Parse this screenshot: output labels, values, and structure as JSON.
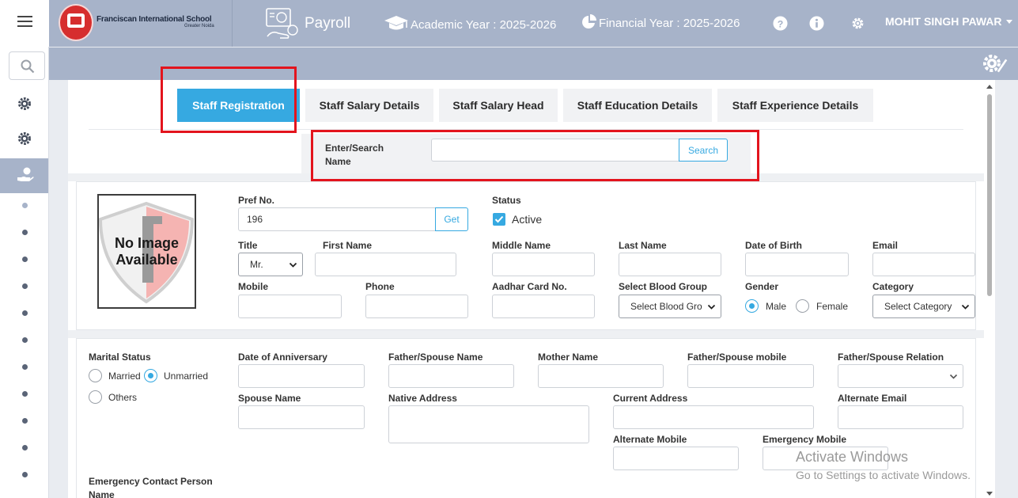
{
  "header": {
    "school_name": "Franciscan International School",
    "school_sub": "Greater Noida",
    "module": "Payroll",
    "academic_year": "Academic Year : 2025-2026",
    "financial_year": "Financial Year : 2025-2026",
    "user": "MOHIT SINGH PAWAR"
  },
  "tabs": [
    {
      "label": "Staff Registration",
      "active": true
    },
    {
      "label": "Staff Salary Details",
      "active": false
    },
    {
      "label": "Staff Salary Head",
      "active": false
    },
    {
      "label": "Staff Education Details",
      "active": false
    },
    {
      "label": "Staff Experience Details",
      "active": false
    }
  ],
  "search": {
    "label": "Enter/Search Name",
    "button": "Search",
    "value": ""
  },
  "photo": {
    "placeholder": "No Image Available"
  },
  "form": {
    "pref_no": {
      "label": "Pref No.",
      "value": "196",
      "button": "Get"
    },
    "status": {
      "label": "Status",
      "option": "Active",
      "checked": true
    },
    "title": {
      "label": "Title",
      "value": "Mr."
    },
    "first_name": {
      "label": "First Name",
      "value": ""
    },
    "middle_name": {
      "label": "Middle Name",
      "value": ""
    },
    "last_name": {
      "label": "Last Name",
      "value": ""
    },
    "dob": {
      "label": "Date of Birth",
      "value": ""
    },
    "email": {
      "label": "Email",
      "value": ""
    },
    "mobile": {
      "label": "Mobile",
      "value": ""
    },
    "phone": {
      "label": "Phone",
      "value": ""
    },
    "aadhar": {
      "label": "Aadhar Card No.",
      "value": ""
    },
    "blood_group": {
      "label": "Select Blood Group",
      "value": "Select Blood Gro"
    },
    "gender": {
      "label": "Gender",
      "options": [
        "Male",
        "Female"
      ],
      "selected": "Male"
    },
    "category": {
      "label": "Category",
      "value": "Select Category"
    },
    "marital_status": {
      "label": "Marital Status",
      "options": [
        "Married",
        "Unmarried",
        "Others"
      ],
      "selected": "Unmarried"
    },
    "anniversary": {
      "label": "Date of Anniversary",
      "value": ""
    },
    "father_spouse_name": {
      "label": "Father/Spouse Name",
      "value": ""
    },
    "mother_name": {
      "label": "Mother Name",
      "value": ""
    },
    "father_spouse_mobile": {
      "label": "Father/Spouse mobile",
      "value": ""
    },
    "father_spouse_relation": {
      "label": "Father/Spouse Relation",
      "value": ""
    },
    "spouse_name": {
      "label": "Spouse Name",
      "value": ""
    },
    "native_address": {
      "label": "Native Address",
      "value": ""
    },
    "current_address": {
      "label": "Current Address",
      "value": ""
    },
    "alternate_email": {
      "label": "Alternate Email",
      "value": ""
    },
    "alternate_mobile": {
      "label": "Alternate Mobile",
      "value": ""
    },
    "emergency_mobile": {
      "label": "Emergency Mobile",
      "value": ""
    },
    "emergency_contact": {
      "label": "Emergency Contact Person Name"
    }
  },
  "watermark": {
    "line1": "Activate Windows",
    "line2": "Go to Settings to activate Windows."
  },
  "colors": {
    "accent": "#36a9e1",
    "header": "#a7b3c9",
    "highlight": "#e3141d"
  }
}
